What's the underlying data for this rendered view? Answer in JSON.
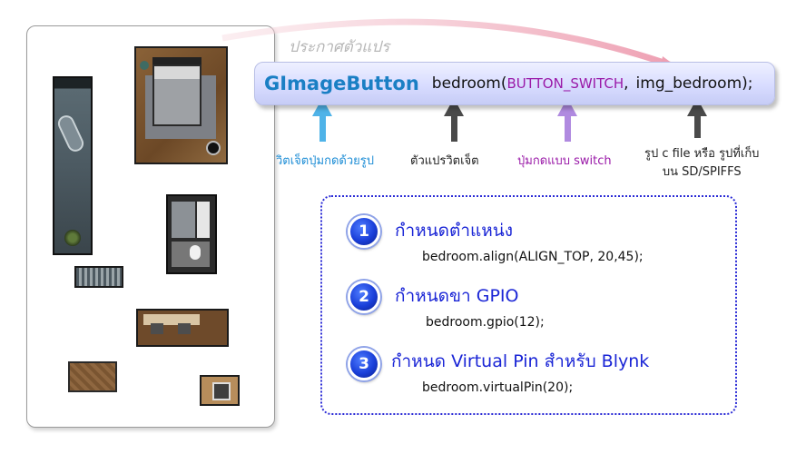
{
  "heading": {
    "label": "ประกาศตัวแปร"
  },
  "code": {
    "class_name": "GImageButton",
    "var_name": "bedroom",
    "open_paren": "(",
    "const_arg": "BUTTON_SWITCH",
    "separator": ",",
    "image_arg": "img_bedroom);"
  },
  "annotations": {
    "class_desc": "วิตเจ็ตปุ่มกดด้วยรูป",
    "var_desc": "ตัวแปรวิตเจ็ต",
    "mode_desc": "ปุ่มกดแบบ switch",
    "image_desc_line1": "รูป c file หรือ รูปที่เก็บ",
    "image_desc_line2": "บน SD/SPIFFS"
  },
  "steps": [
    {
      "number": "1",
      "title": "กำหนดตำแหน่ง",
      "code": "bedroom.align(ALIGN_TOP, 20,45);"
    },
    {
      "number": "2",
      "title": "กำหนดขา GPIO",
      "code": "bedroom.gpio(12);"
    },
    {
      "number": "3",
      "title": "กำหนด Virtual Pin สำหรับ Blynk",
      "code": "bedroom.virtualPin(20);"
    }
  ],
  "colors": {
    "class_blue": "#1a7fc4",
    "const_purple": "#9a1aa8",
    "step_blue": "#1a25d6",
    "arrow_blue": "#4fb3e8",
    "arrow_purple": "#b08ae0",
    "arrow_gray": "#4a4a4a",
    "curve_pink": "#f3b7c4"
  }
}
